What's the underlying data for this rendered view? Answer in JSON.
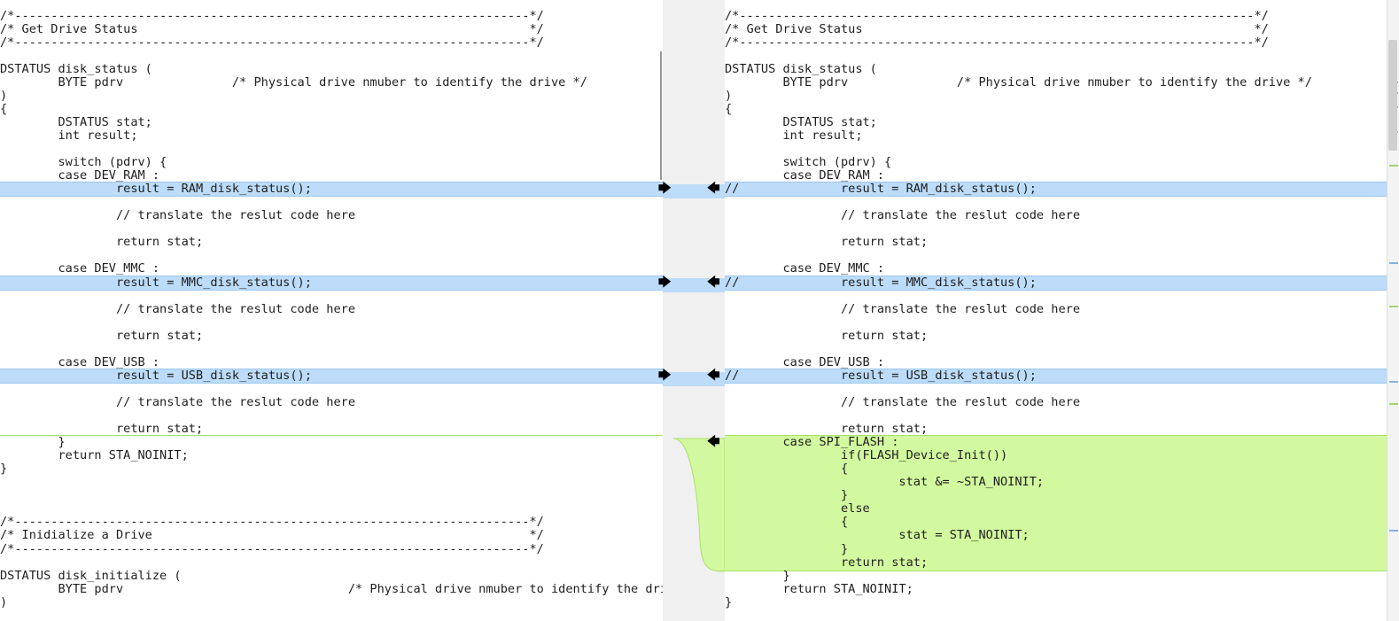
{
  "left": {
    "lines": [
      {
        "t": "/*-----------------------------------------------------------------------*/"
      },
      {
        "t": "/* Get Drive Status                                                      */"
      },
      {
        "t": "/*-----------------------------------------------------------------------*/"
      },
      {
        "t": ""
      },
      {
        "t": "DSTATUS disk_status ("
      },
      {
        "t": "        BYTE pdrv               /* Physical drive nmuber to identify the drive */"
      },
      {
        "t": ")"
      },
      {
        "t": "{"
      },
      {
        "t": "        DSTATUS stat;"
      },
      {
        "t": "        int result;"
      },
      {
        "t": ""
      },
      {
        "t": "        switch (pdrv) {"
      },
      {
        "t": "        case DEV_RAM :"
      },
      {
        "t": "                result = RAM_disk_status();",
        "hl": true
      },
      {
        "t": ""
      },
      {
        "t": "                // translate the reslut code here"
      },
      {
        "t": ""
      },
      {
        "t": "                return stat;"
      },
      {
        "t": ""
      },
      {
        "t": "        case DEV_MMC :"
      },
      {
        "t": "                result = MMC_disk_status();",
        "hl": true
      },
      {
        "t": ""
      },
      {
        "t": "                // translate the reslut code here"
      },
      {
        "t": ""
      },
      {
        "t": "                return stat;"
      },
      {
        "t": ""
      },
      {
        "t": "        case DEV_USB :"
      },
      {
        "t": "                result = USB_disk_status();",
        "hl": true
      },
      {
        "t": ""
      },
      {
        "t": "                // translate the reslut code here"
      },
      {
        "t": ""
      },
      {
        "t": "                return stat;"
      },
      {
        "t": "        }"
      },
      {
        "t": "        return STA_NOINIT;"
      },
      {
        "t": "}"
      },
      {
        "t": ""
      },
      {
        "t": ""
      },
      {
        "t": ""
      },
      {
        "t": "/*-----------------------------------------------------------------------*/"
      },
      {
        "t": "/* Inidialize a Drive                                                    */"
      },
      {
        "t": "/*-----------------------------------------------------------------------*/"
      },
      {
        "t": ""
      },
      {
        "t": "DSTATUS disk_initialize ("
      },
      {
        "t": "        BYTE pdrv                               /* Physical drive nmuber to identify the drive */"
      },
      {
        "t": ")"
      }
    ]
  },
  "right": {
    "lines": [
      {
        "t": "/*-----------------------------------------------------------------------*/"
      },
      {
        "t": "/* Get Drive Status                                                      */"
      },
      {
        "t": "/*-----------------------------------------------------------------------*/"
      },
      {
        "t": ""
      },
      {
        "t": "DSTATUS disk_status ("
      },
      {
        "t": "        BYTE pdrv               /* Physical drive nmuber to identify the drive */"
      },
      {
        "t": ")"
      },
      {
        "t": "{"
      },
      {
        "t": "        DSTATUS stat;"
      },
      {
        "t": "        int result;"
      },
      {
        "t": ""
      },
      {
        "t": "        switch (pdrv) {"
      },
      {
        "t": "        case DEV_RAM :"
      },
      {
        "t": "//              result = RAM_disk_status();",
        "hl": true
      },
      {
        "t": ""
      },
      {
        "t": "                // translate the reslut code here"
      },
      {
        "t": ""
      },
      {
        "t": "                return stat;"
      },
      {
        "t": ""
      },
      {
        "t": "        case DEV_MMC :"
      },
      {
        "t": "//              result = MMC_disk_status();",
        "hl": true
      },
      {
        "t": ""
      },
      {
        "t": "                // translate the reslut code here"
      },
      {
        "t": ""
      },
      {
        "t": "                return stat;"
      },
      {
        "t": ""
      },
      {
        "t": "        case DEV_USB :"
      },
      {
        "t": "//              result = USB_disk_status();",
        "hl": true
      },
      {
        "t": ""
      },
      {
        "t": "                // translate the reslut code here"
      },
      {
        "t": ""
      },
      {
        "t": "                return stat;"
      },
      {
        "t": "        case SPI_FLASH :",
        "add": true
      },
      {
        "t": "                if(FLASH_Device_Init())",
        "add": true
      },
      {
        "t": "                {",
        "add": true
      },
      {
        "t": "                        stat &= ~STA_NOINIT;",
        "add": true
      },
      {
        "t": "                }",
        "add": true
      },
      {
        "t": "                else",
        "add": true
      },
      {
        "t": "                {",
        "add": true
      },
      {
        "t": "                        stat = STA_NOINIT;",
        "add": true
      },
      {
        "t": "                }",
        "add": true
      },
      {
        "t": "                return stat;",
        "add": true
      },
      {
        "t": "        }"
      },
      {
        "t": "        return STA_NOINIT;"
      },
      {
        "t": "}"
      }
    ]
  },
  "gutter": {
    "copy_right_icon": "arrow-right-icon",
    "copy_left_icon": "arrow-left-icon",
    "copy_right_glyph": "🡆",
    "copy_left_glyph": "🡄"
  },
  "colors": {
    "changed": "#bcdcf9",
    "added": "#d2f99f",
    "added_border": "#a8e06a"
  }
}
